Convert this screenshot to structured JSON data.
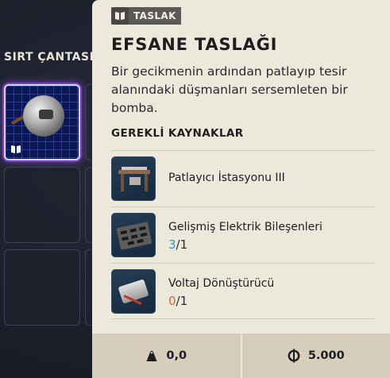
{
  "inventory": {
    "section_title": "SIRT ÇANTASI"
  },
  "tooltip": {
    "tag_icon": "book-icon",
    "tag_label": "TASLAK",
    "title": "EFSANE TASLAĞI",
    "description": "Bir gecikmenin ardından patlayıp tesir alanındaki düşmanları sersemleten bir bomba.",
    "requirements_header": "GEREKLİ KAYNAKLAR",
    "requirements": [
      {
        "name": "Patlayıcı İstasyonu III",
        "icon": "workbench-icon",
        "have": "",
        "sep": "",
        "need": ""
      },
      {
        "name": "Gelişmiş Elektrik Bileşenleri",
        "icon": "circuit-board-icon",
        "have": "3",
        "sep": "/",
        "need": "1"
      },
      {
        "name": "Voltaj Dönüştürücü",
        "icon": "voltage-converter-icon",
        "have": "0",
        "sep": "/",
        "need": "1"
      }
    ],
    "footer": {
      "weight_icon": "weight-icon",
      "weight": "0,0",
      "currency_icon": "coin-icon",
      "value": "5.000"
    }
  },
  "colors": {
    "panel_bg": "#ede8dc",
    "footer_bg": "#d6cdbc",
    "legendary_glow": "#7a3fc4",
    "count_ok": "#3b93b8",
    "count_low": "#d2643a"
  }
}
